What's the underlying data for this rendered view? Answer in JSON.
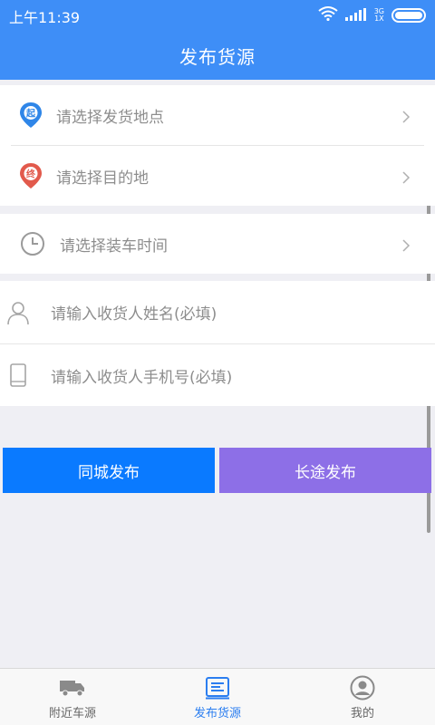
{
  "status_bar": {
    "time": "上午11:39",
    "network_top": "3G",
    "network_bottom": "1X"
  },
  "header": {
    "title": "发布货源"
  },
  "location_card": {
    "origin_label": "请选择发货地点",
    "origin_pin_text": "起",
    "destination_label": "请选择目的地",
    "destination_pin_text": "终"
  },
  "time_card": {
    "loading_time_label": "请选择装车时间"
  },
  "receiver_card": {
    "name_placeholder": "请输入收货人姓名(必填)",
    "phone_placeholder": "请输入收货人手机号(必填)"
  },
  "actions": {
    "same_city_label": "同城发布",
    "long_distance_label": "长途发布"
  },
  "bottom_nav": {
    "items": [
      {
        "label": "附近车源"
      },
      {
        "label": "发布货源"
      },
      {
        "label": "我的"
      }
    ],
    "active_color": "#2b7ef0"
  },
  "colors": {
    "header_bg": "#3e8ef7",
    "same_city_bg": "#0a7aff",
    "long_distance_bg": "#8d6fe7",
    "origin_pin": "#2f86e8",
    "destination_pin": "#e25a4c"
  }
}
